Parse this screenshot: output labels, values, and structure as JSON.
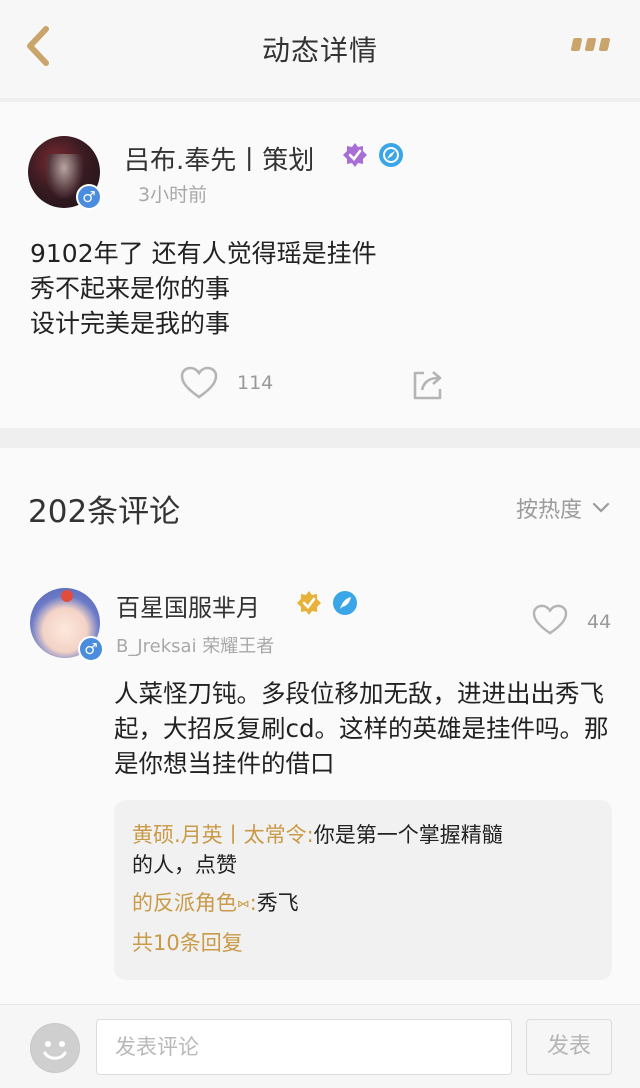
{
  "header": {
    "title": "动态详情"
  },
  "post": {
    "author": "吕布.奉先丨策划",
    "gender_symbol": "♂",
    "time": "3小时前",
    "content_lines": [
      "9102年了 还有人觉得瑶是挂件",
      "秀不起来是你的事",
      "设计完美是我的事"
    ],
    "like_count": "114"
  },
  "comments": {
    "count_label": "202条评论",
    "sort_label": "按热度",
    "items": [
      {
        "name": "百星国服芈月",
        "gender_symbol": "♂",
        "subtitle": "B_Jreksai 荣耀王者",
        "like_count": "44",
        "text": "人菜怪刀钝。多段位移加无敌，进进出出秀飞起，大招反复刷cd。这样的英雄是挂件吗。那是你想当挂件的借口",
        "replies": [
          {
            "author": "黄硕.月英丨太常令:",
            "text": "你是第一个掌握精髓",
            "text2": "的人，点赞"
          },
          {
            "author": "的反派角色⑅:",
            "text": "秀飞"
          }
        ],
        "more_replies": "共10条回复"
      }
    ]
  },
  "bottom_bar": {
    "input_placeholder": "发表评论",
    "send_label": "发表"
  },
  "colors": {
    "accent_gold": "#c99a47",
    "gender_blue": "#4a8ddf",
    "background": "#efeff0"
  }
}
